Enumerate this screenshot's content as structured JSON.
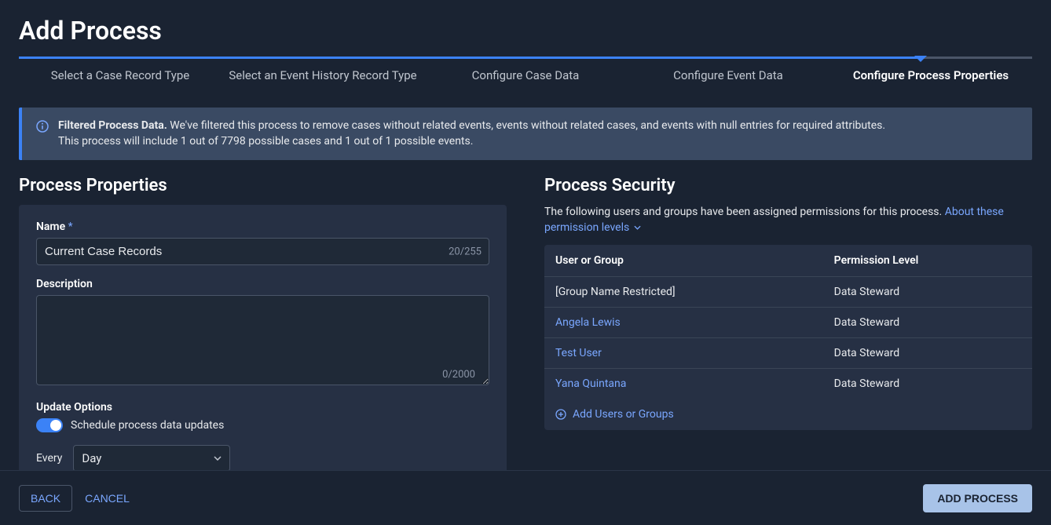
{
  "header": {
    "title": "Add Process"
  },
  "stepper": {
    "progress_percent": 89,
    "pointer_percent": 89,
    "steps": [
      {
        "label": "Select a Case Record Type",
        "active": false
      },
      {
        "label": "Select an Event History Record Type",
        "active": false
      },
      {
        "label": "Configure Case Data",
        "active": false
      },
      {
        "label": "Configure Event Data",
        "active": false
      },
      {
        "label": "Configure Process Properties",
        "active": true
      }
    ]
  },
  "info_banner": {
    "strong": "Filtered Process Data.",
    "text1": "We've filtered this process to remove cases without related events, events without related cases, and events with null entries for required attributes.",
    "text2": "This process will include 1 out of 7798 possible cases and 1 out of 1 possible events."
  },
  "process_properties": {
    "heading": "Process Properties",
    "name_label": "Name",
    "name_required": "*",
    "name_value": "Current Case Records",
    "name_count": "20/255",
    "desc_label": "Description",
    "desc_value": "",
    "desc_count": "0/2000",
    "update_label": "Update Options",
    "toggle_label": "Schedule process data updates",
    "schedule_prefix": "Every",
    "schedule_value": "Day"
  },
  "process_security": {
    "heading": "Process Security",
    "desc": "The following users and groups have been assigned permissions for this process.",
    "link": "About these permission levels",
    "th_user": "User or Group",
    "th_perm": "Permission Level",
    "rows": [
      {
        "name": "[Group Name Restricted]",
        "perm": "Data Steward",
        "is_link": false
      },
      {
        "name": "Angela Lewis",
        "perm": "Data Steward",
        "is_link": true
      },
      {
        "name": "Test User",
        "perm": "Data Steward",
        "is_link": true
      },
      {
        "name": "Yana Quintana",
        "perm": "Data Steward",
        "is_link": true
      }
    ],
    "add_label": "Add Users or Groups"
  },
  "footer": {
    "back": "BACK",
    "cancel": "CANCEL",
    "primary": "ADD PROCESS"
  }
}
